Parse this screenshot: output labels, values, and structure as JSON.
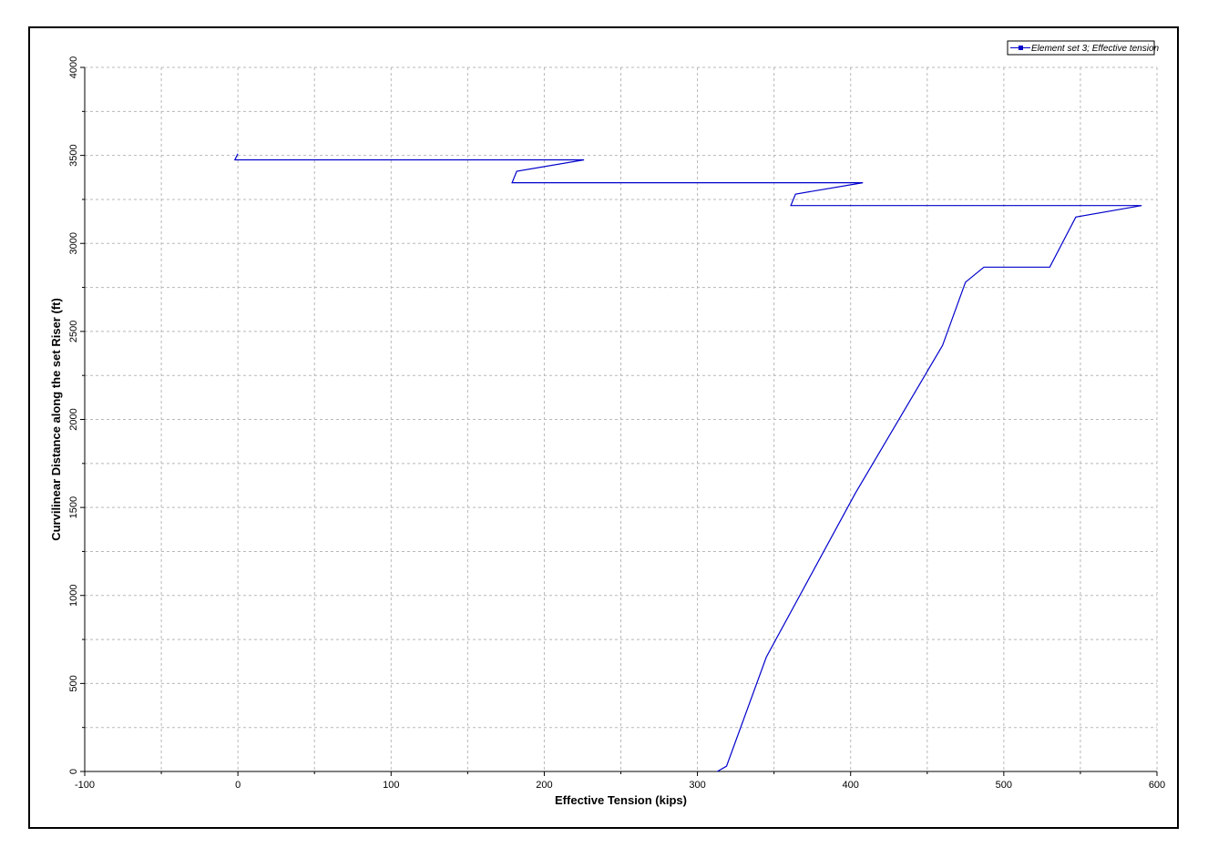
{
  "chart_data": {
    "type": "line",
    "xlabel": "Effective Tension  (kips)",
    "ylabel": "Curvilinear Distance along the set Riser (ft)",
    "xlim": [
      -100,
      600
    ],
    "ylim": [
      0,
      4000
    ],
    "x_ticks": [
      -100,
      0,
      100,
      200,
      300,
      400,
      500,
      600
    ],
    "y_ticks": [
      0,
      500,
      1000,
      1500,
      2000,
      2500,
      3000,
      3500,
      4000
    ],
    "grid": true,
    "legend_position": "top-right",
    "series": [
      {
        "name": "Element set  3; Effective tension",
        "color": "#0000cc",
        "points": [
          [
            313,
            0
          ],
          [
            319,
            30
          ],
          [
            345,
            650
          ],
          [
            403,
            1580
          ],
          [
            460,
            2420
          ],
          [
            475,
            2780
          ],
          [
            487,
            2865
          ],
          [
            530,
            2865
          ],
          [
            547,
            3150
          ],
          [
            590,
            3215
          ],
          [
            361,
            3215
          ],
          [
            364,
            3280
          ],
          [
            408,
            3345
          ],
          [
            179,
            3345
          ],
          [
            182,
            3410
          ],
          [
            226,
            3475
          ],
          [
            -2,
            3475
          ],
          [
            0,
            3510
          ]
        ]
      }
    ]
  }
}
